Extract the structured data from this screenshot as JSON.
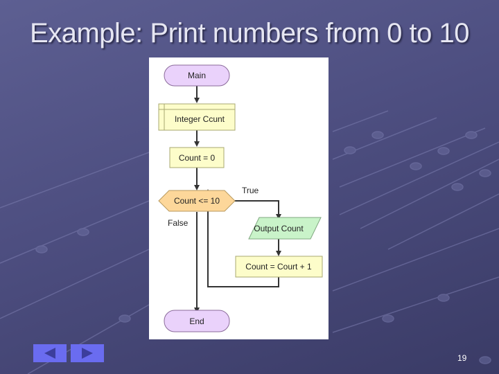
{
  "slide": {
    "title": "Example: Print numbers from 0 to 10",
    "page_number": "19"
  },
  "flowchart": {
    "start": "Main",
    "declare": "Integer Ccunt",
    "assign_init": "Count = 0",
    "decision": "Count <= 10",
    "true_label": "True",
    "false_label": "False",
    "output": "Output Count",
    "assign_inc": "Count = Court + 1",
    "end": "End",
    "colors": {
      "terminal": "#ead2fb",
      "process": "#fdfdca",
      "decision": "#fdd79a",
      "io": "#c9f3c9",
      "line": "#333333"
    }
  },
  "nav": {
    "prev_icon": "triangle-left-icon",
    "next_icon": "triangle-right-icon"
  }
}
